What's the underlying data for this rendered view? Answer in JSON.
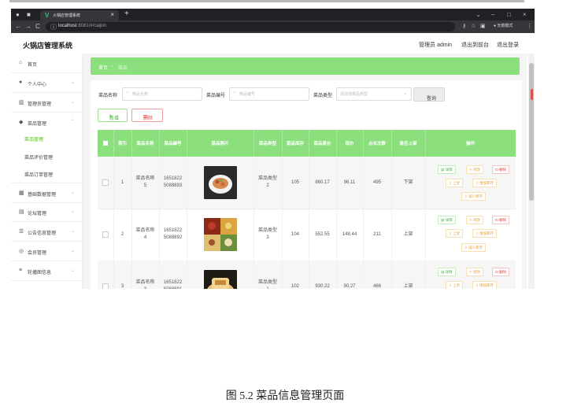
{
  "browser": {
    "tab_title": "火锅店管理系统",
    "url_host": "localhost",
    "url_rest": ":8081/#/caipin",
    "incognito_label": "无痕模式"
  },
  "app": {
    "title": "火锅店管理系统",
    "admin_label": "管理员 admin",
    "to_front": "退出到前台",
    "logout": "退出登录"
  },
  "sidebar": {
    "items": [
      {
        "label": "首页",
        "icon": "home-icon"
      },
      {
        "label": "个人中心",
        "icon": "user-icon"
      },
      {
        "label": "管理员管理",
        "icon": "bar-chart-icon"
      },
      {
        "label": "菜品管理",
        "icon": "pin-icon"
      },
      {
        "label": "基础数据管理",
        "icon": "grid-icon"
      },
      {
        "label": "论坛管理",
        "icon": "forum-icon"
      },
      {
        "label": "公告信息管理",
        "icon": "list-icon"
      },
      {
        "label": "会员管理",
        "icon": "member-icon"
      },
      {
        "label": "轮播图信息",
        "icon": "carousel-icon"
      }
    ],
    "submenu": [
      "菜品管理",
      "菜品评价管理",
      "菜品订单管理"
    ]
  },
  "breadcrumb": {
    "home": "首页",
    "sep": "→",
    "current": "菜品"
  },
  "filters": {
    "name_label": "菜品名称",
    "name_placeholder": "菜品名称",
    "code_label": "菜品编号",
    "code_placeholder": "菜品编号",
    "type_label": "菜品类型",
    "type_placeholder": "请选择菜品类型",
    "query_button": "查询"
  },
  "actions": {
    "add": "新增",
    "delete": "删除"
  },
  "table": {
    "headers": [
      "索引",
      "菜品名称",
      "菜品编号",
      "菜品照片",
      "菜品类型",
      "菜品库存",
      "菜品原价",
      "现价",
      "点击次数",
      "是否上架",
      "操作"
    ],
    "rows": [
      {
        "index": "1",
        "name": "菜品名称\n5",
        "code": "1651822\n5088893",
        "type": "菜品类型\n2",
        "stock": "105",
        "price": "860.17",
        "now": "96.11",
        "clicks": "495",
        "status": "下架"
      },
      {
        "index": "2",
        "name": "菜品名称\n4",
        "code": "1651822\n5088892",
        "type": "菜品类型\n3",
        "stock": "104",
        "price": "552.55",
        "now": "148.44",
        "clicks": "211",
        "status": "上架"
      },
      {
        "index": "3",
        "name": "菜品名称\n3",
        "code": "1651822\n5088891",
        "type": "菜品类型\n1",
        "stock": "102",
        "price": "930.22",
        "now": "90.27",
        "clicks": "466",
        "status": "上架"
      }
    ],
    "op_labels": {
      "detail": "详情",
      "edit": "修改",
      "delete": "删除",
      "up": "上架",
      "add_stock": "增加库存",
      "reduce_stock": "减少库存"
    }
  },
  "caption": "图 5.2  菜品信息管理页面",
  "colors": {
    "accent": "#8be07d",
    "active_menu": "#52c41a"
  }
}
